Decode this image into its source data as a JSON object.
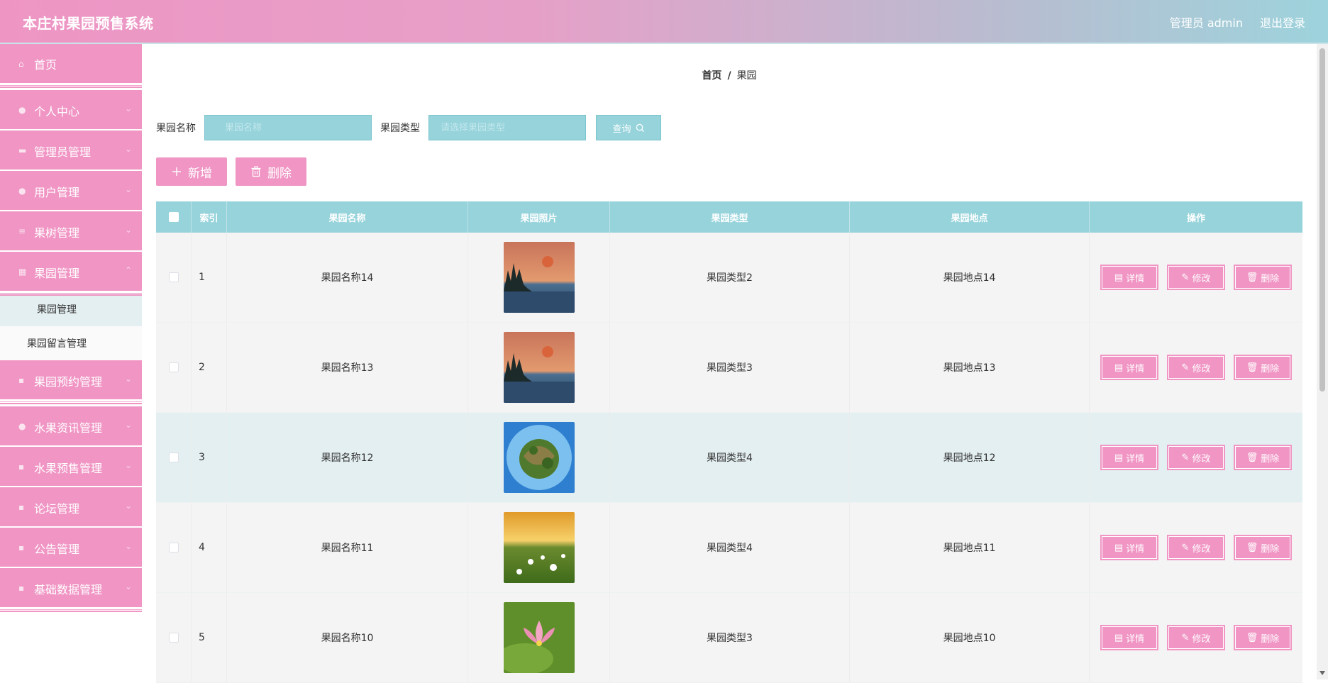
{
  "header": {
    "title": "本庄村果园预售系统",
    "user": "管理员 admin",
    "logout": "退出登录"
  },
  "sidebar": {
    "items": [
      {
        "label": "首页",
        "icon": "home-icon"
      },
      {
        "label": "个人中心",
        "icon": "user-icon"
      },
      {
        "label": "管理员管理",
        "icon": "briefcase-icon"
      },
      {
        "label": "用户管理",
        "icon": "user-icon"
      },
      {
        "label": "果树管理",
        "icon": "list-icon"
      },
      {
        "label": "果园管理",
        "icon": "calendar-icon"
      }
    ],
    "submenu": [
      {
        "label": "果园管理"
      },
      {
        "label": "果园留言管理"
      }
    ],
    "items_after": [
      {
        "label": "果园预约管理",
        "icon": "grid-icon"
      },
      {
        "label": "水果资讯管理",
        "icon": "chat-icon"
      },
      {
        "label": "水果预售管理",
        "icon": "grid-icon"
      },
      {
        "label": "论坛管理",
        "icon": "grid-icon"
      },
      {
        "label": "公告管理",
        "icon": "grid-icon"
      },
      {
        "label": "基础数据管理",
        "icon": "grid-icon"
      }
    ]
  },
  "breadcrumb": {
    "home": "首页",
    "sep": "/",
    "current": "果园"
  },
  "search": {
    "name_label": "果园名称",
    "name_placeholder": "果园名称",
    "type_label": "果园类型",
    "type_placeholder": "请选择果园类型",
    "query_label": "查询"
  },
  "actions": {
    "add_label": "新增",
    "delete_label": "删除"
  },
  "table": {
    "headers": {
      "index": "索引",
      "name": "果园名称",
      "photo": "果园照片",
      "type": "果园类型",
      "location": "果园地点",
      "ops": "操作"
    },
    "rows": [
      {
        "index": "1",
        "name": "果园名称14",
        "type": "果园类型2",
        "location": "果园地点14",
        "photo": "sunset-lake"
      },
      {
        "index": "2",
        "name": "果园名称13",
        "type": "果园类型3",
        "location": "果园地点13",
        "photo": "sunset-lake"
      },
      {
        "index": "3",
        "name": "果园名称12",
        "type": "果园类型4",
        "location": "果园地点12",
        "photo": "tiny-planet"
      },
      {
        "index": "4",
        "name": "果园名称11",
        "type": "果园类型4",
        "location": "果园地点11",
        "photo": "flower-field"
      },
      {
        "index": "5",
        "name": "果园名称10",
        "type": "果园类型3",
        "location": "果园地点10",
        "photo": "lotus"
      }
    ],
    "op_labels": {
      "detail": "详情",
      "edit": "修改",
      "delete": "删除"
    }
  },
  "colors": {
    "pink": "#f095c4",
    "teal": "#96d3db",
    "highlight_row": "#e4eff1"
  }
}
